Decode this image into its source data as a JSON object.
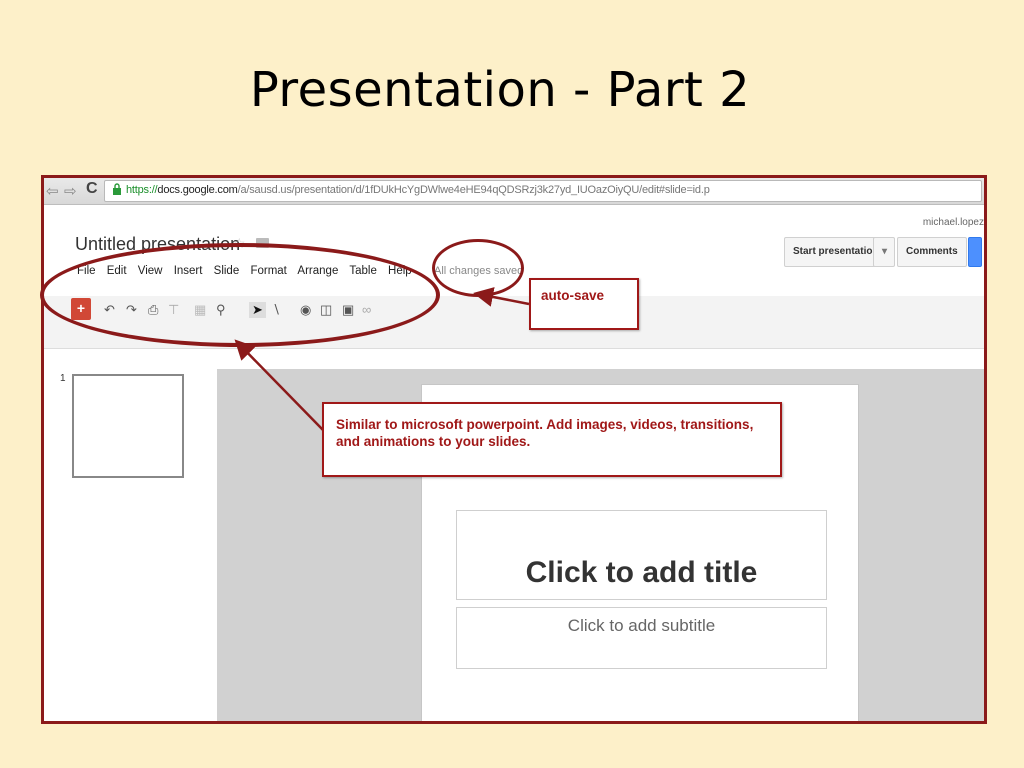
{
  "slide": {
    "title": "Presentation - Part 2"
  },
  "browser": {
    "url_scheme": "https://",
    "url_host": "docs.google.com",
    "url_path": "/a/sausd.us/presentation/d/1fDUkHcYgDWlwe4eHE94qQDSRzj3k27yd_IUOazOiyQU/edit#slide=id.p"
  },
  "app": {
    "user": "michael.lopez",
    "doc_title": "Untitled presentation",
    "menu": [
      "File",
      "Edit",
      "View",
      "Insert",
      "Slide",
      "Format",
      "Arrange",
      "Table",
      "Help"
    ],
    "save_status": "All changes saved",
    "start_presentation_label": "Start presentation",
    "comments_label": "Comments",
    "slide_number": "1",
    "title_placeholder": "Click to add title",
    "subtitle_placeholder": "Click to add subtitle"
  },
  "annotations": {
    "autosave": "auto-save",
    "similar": "Similar to microsoft powerpoint. Add images, videos, transitions, and animations to your slides."
  },
  "colors": {
    "accent": "#8b1a1a",
    "background": "#fdf0c9",
    "share_blue": "#4d90fe",
    "add_red": "#d14836"
  }
}
